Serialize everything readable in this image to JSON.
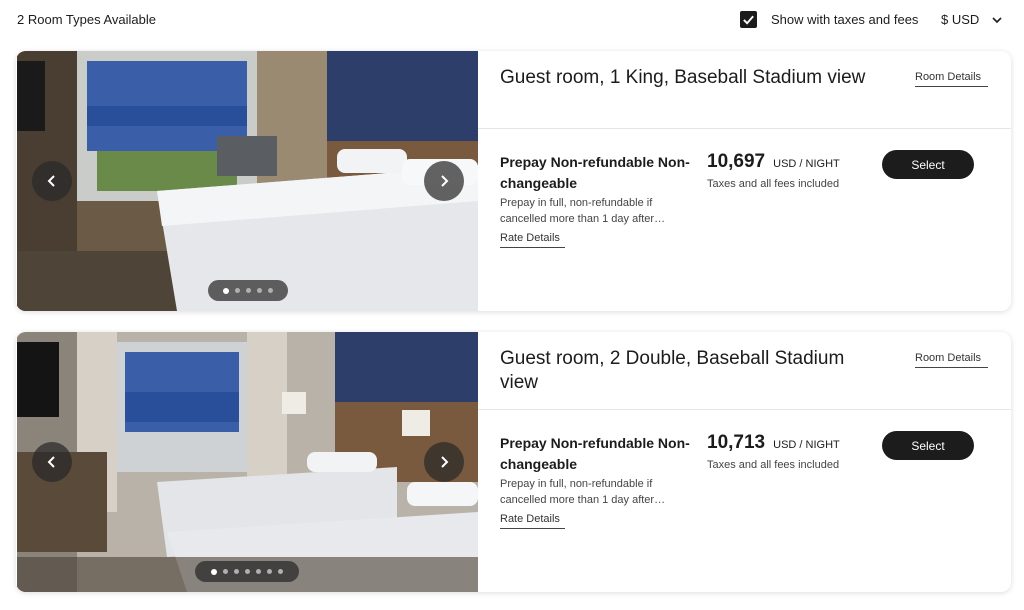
{
  "header": {
    "room_count": "2 Room Types Available",
    "tax_toggle_label": "Show with taxes and fees",
    "tax_toggle_checked": true,
    "currency": "$ USD"
  },
  "rooms": [
    {
      "title": "Guest room, 1 King, Baseball Stadium view",
      "room_details_link": "Room Details",
      "rate_name": "Prepay Non-refundable Non-changeable",
      "rate_description": "Prepay in full, non-refundable if cancelled more than 1 day after…",
      "rate_details_link": "Rate Details",
      "price": "10,697",
      "price_unit": "USD / NIGHT",
      "price_note": "Taxes and all fees included",
      "select_label": "Select",
      "photo_count": 5,
      "active_photo": 1,
      "image_icon": "hotel-room-photo"
    },
    {
      "title": "Guest room, 2 Double, Baseball Stadium view",
      "room_details_link": "Room Details",
      "rate_name": "Prepay Non-refundable Non-changeable",
      "rate_description": "Prepay in full, non-refundable if cancelled more than 1 day after…",
      "rate_details_link": "Rate Details",
      "price": "10,713",
      "price_unit": "USD / NIGHT",
      "price_note": "Taxes and all fees included",
      "select_label": "Select",
      "photo_count": 7,
      "active_photo": 1,
      "image_icon": "hotel-room-photo"
    }
  ],
  "colors": {
    "primary_button": "#1c1c1c",
    "text": "#1c1c1c",
    "stadium_seats": "#2a4f9a"
  }
}
